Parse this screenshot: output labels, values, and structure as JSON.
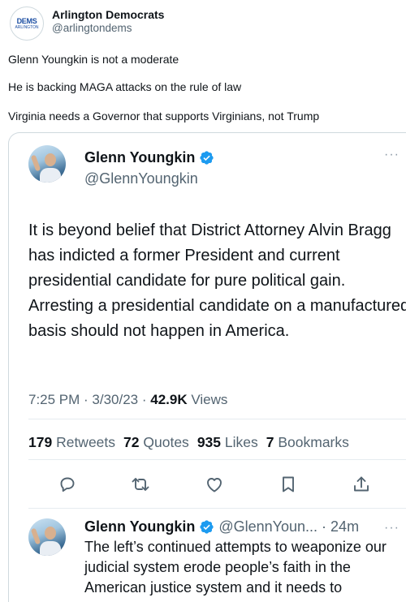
{
  "outer": {
    "logo_line1": "DEMS",
    "logo_line2": "ARLINGTON",
    "name": "Arlington Democrats",
    "handle": "@arlingtondems",
    "lines": [
      "Glenn Youngkin is not a moderate",
      "He is backing MAGA attacks on the rule of law",
      "Virginia needs a Governor that supports Virginians, not Trump"
    ]
  },
  "quoted": {
    "name": "Glenn Youngkin",
    "handle": "@GlennYoungkin",
    "more": "···",
    "text": "It is beyond belief that District Attorney Alvin Bragg has indicted a former President and current presidential candidate for pure political gain. Arresting a presidential candidate on a manufactured basis should not happen in America.",
    "time": "7:25 PM · 3/30/23 · ",
    "views_count": "42.9K",
    "views_label": " Views",
    "stats": {
      "retweets_count": "179",
      "retweets_label": "Retweets",
      "quotes_count": "72",
      "quotes_label": "Quotes",
      "likes_count": "935",
      "likes_label": "Likes",
      "bookmarks_count": "7",
      "bookmarks_label": "Bookmarks"
    },
    "icons": [
      "reply-icon",
      "retweet-icon",
      "like-icon",
      "bookmark-icon",
      "share-icon"
    ]
  },
  "reply": {
    "name": "Glenn Youngkin",
    "handle": "@GlennYoun...",
    "time": "· 24m",
    "more": "···",
    "text": "The left’s continued attempts to weaponize our judicial system erode people’s faith in the American justice system and it needs to"
  },
  "colors": {
    "accent": "#1d9bf0",
    "secondary_text": "#536471",
    "border": "#cfd9de"
  }
}
